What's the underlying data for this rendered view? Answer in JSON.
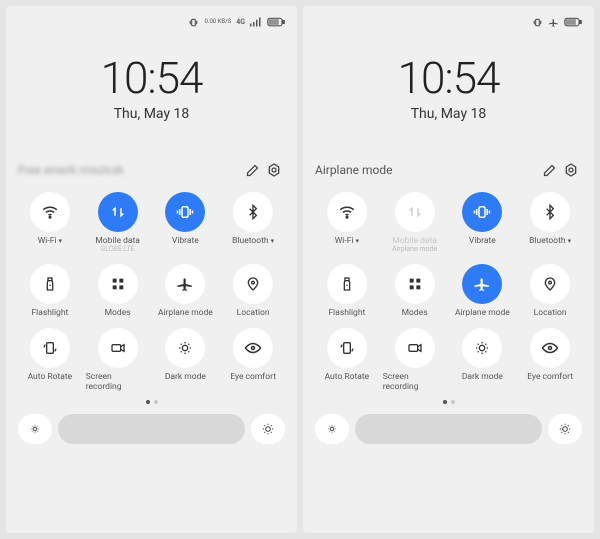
{
  "panels": [
    {
      "statusbar": {
        "items": [
          "vibrate",
          "speed",
          "signal-4g",
          "signal-bars",
          "battery"
        ],
        "speed_text": "0.00 KB/S"
      },
      "time": "10:54",
      "date": "Thu, May 18",
      "header_label": "Free enwrk mixzirzk",
      "header_blurred": true,
      "tiles": [
        {
          "icon": "wifi",
          "label": "Wi-Fi",
          "active": false,
          "dropdown": true
        },
        {
          "icon": "mobiledata",
          "label": "Mobile data",
          "active": true,
          "sub": "GLOBE LTE"
        },
        {
          "icon": "vibrate",
          "label": "Vibrate",
          "active": true
        },
        {
          "icon": "bluetooth",
          "label": "Bluetooth",
          "active": false,
          "dropdown": true
        },
        {
          "icon": "flashlight",
          "label": "Flashlight",
          "active": false
        },
        {
          "icon": "modes",
          "label": "Modes",
          "active": false
        },
        {
          "icon": "airplane",
          "label": "Airplane mode",
          "active": false
        },
        {
          "icon": "location",
          "label": "Location",
          "active": false
        },
        {
          "icon": "autorotate",
          "label": "Auto Rotate",
          "active": false
        },
        {
          "icon": "screenrec",
          "label": "Screen recording",
          "active": false
        },
        {
          "icon": "darkmode",
          "label": "Dark mode",
          "active": false
        },
        {
          "icon": "eyecomfort",
          "label": "Eye comfort",
          "active": false
        }
      ],
      "page_indicator": {
        "count": 2,
        "active": 0
      }
    },
    {
      "statusbar": {
        "items": [
          "vibrate",
          "airplane",
          "battery"
        ]
      },
      "time": "10:54",
      "date": "Thu, May 18",
      "header_label": "Airplane mode",
      "header_blurred": false,
      "tiles": [
        {
          "icon": "wifi",
          "label": "Wi-Fi",
          "active": false,
          "dropdown": true
        },
        {
          "icon": "mobiledata",
          "label": "Mobile data",
          "active": false,
          "disabled": true,
          "sub": "Airplane mode"
        },
        {
          "icon": "vibrate",
          "label": "Vibrate",
          "active": true
        },
        {
          "icon": "bluetooth",
          "label": "Bluetooth",
          "active": false,
          "dropdown": true
        },
        {
          "icon": "flashlight",
          "label": "Flashlight",
          "active": false
        },
        {
          "icon": "modes",
          "label": "Modes",
          "active": false
        },
        {
          "icon": "airplane",
          "label": "Airplane mode",
          "active": true
        },
        {
          "icon": "location",
          "label": "Location",
          "active": false
        },
        {
          "icon": "autorotate",
          "label": "Auto Rotate",
          "active": false
        },
        {
          "icon": "screenrec",
          "label": "Screen recording",
          "active": false
        },
        {
          "icon": "darkmode",
          "label": "Dark mode",
          "active": false
        },
        {
          "icon": "eyecomfort",
          "label": "Eye comfort",
          "active": false
        }
      ],
      "page_indicator": {
        "count": 2,
        "active": 0
      }
    }
  ]
}
